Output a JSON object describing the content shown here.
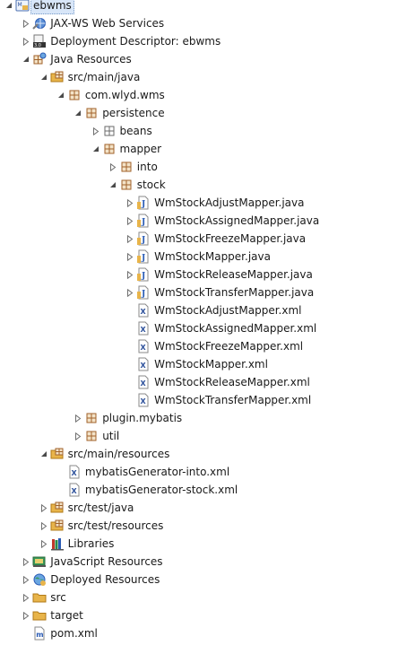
{
  "tree": {
    "nodes": [
      {
        "id": "ebwms",
        "label": "ebwms",
        "depth": 0,
        "state": "expanded",
        "icon": "project-icon",
        "selected": true
      },
      {
        "id": "jaxws",
        "label": "JAX-WS Web Services",
        "depth": 1,
        "state": "collapsed",
        "icon": "webservices-icon"
      },
      {
        "id": "deploydesc",
        "label": "Deployment Descriptor: ebwms",
        "depth": 1,
        "state": "collapsed",
        "icon": "deployment-descriptor-icon"
      },
      {
        "id": "javares",
        "label": "Java Resources",
        "depth": 1,
        "state": "expanded",
        "icon": "java-resources-icon"
      },
      {
        "id": "srcmainjava",
        "label": "src/main/java",
        "depth": 2,
        "state": "expanded",
        "icon": "source-folder-icon"
      },
      {
        "id": "comwlydwms",
        "label": "com.wlyd.wms",
        "depth": 3,
        "state": "expanded",
        "icon": "package-icon"
      },
      {
        "id": "persistence",
        "label": "persistence",
        "depth": 4,
        "state": "expanded",
        "icon": "package-icon"
      },
      {
        "id": "beans",
        "label": "beans",
        "depth": 5,
        "state": "collapsed",
        "icon": "package-empty-icon"
      },
      {
        "id": "mapper",
        "label": "mapper",
        "depth": 5,
        "state": "expanded",
        "icon": "package-icon"
      },
      {
        "id": "into",
        "label": "into",
        "depth": 6,
        "state": "collapsed",
        "icon": "package-icon"
      },
      {
        "id": "stock",
        "label": "stock",
        "depth": 6,
        "state": "expanded",
        "icon": "package-icon"
      },
      {
        "id": "j1",
        "label": "WmStockAdjustMapper.java",
        "depth": 7,
        "state": "collapsed",
        "icon": "java-file-icon"
      },
      {
        "id": "j2",
        "label": "WmStockAssignedMapper.java",
        "depth": 7,
        "state": "collapsed",
        "icon": "java-file-icon"
      },
      {
        "id": "j3",
        "label": "WmStockFreezeMapper.java",
        "depth": 7,
        "state": "collapsed",
        "icon": "java-file-icon"
      },
      {
        "id": "j4",
        "label": "WmStockMapper.java",
        "depth": 7,
        "state": "collapsed",
        "icon": "java-file-icon"
      },
      {
        "id": "j5",
        "label": "WmStockReleaseMapper.java",
        "depth": 7,
        "state": "collapsed",
        "icon": "java-file-icon"
      },
      {
        "id": "j6",
        "label": "WmStockTransferMapper.java",
        "depth": 7,
        "state": "collapsed",
        "icon": "java-file-icon"
      },
      {
        "id": "x1",
        "label": "WmStockAdjustMapper.xml",
        "depth": 7,
        "state": "leaf",
        "icon": "xml-file-icon"
      },
      {
        "id": "x2",
        "label": "WmStockAssignedMapper.xml",
        "depth": 7,
        "state": "leaf",
        "icon": "xml-file-icon"
      },
      {
        "id": "x3",
        "label": "WmStockFreezeMapper.xml",
        "depth": 7,
        "state": "leaf",
        "icon": "xml-file-icon"
      },
      {
        "id": "x4",
        "label": "WmStockMapper.xml",
        "depth": 7,
        "state": "leaf",
        "icon": "xml-file-icon"
      },
      {
        "id": "x5",
        "label": "WmStockReleaseMapper.xml",
        "depth": 7,
        "state": "leaf",
        "icon": "xml-file-icon"
      },
      {
        "id": "x6",
        "label": "WmStockTransferMapper.xml",
        "depth": 7,
        "state": "leaf",
        "icon": "xml-file-icon"
      },
      {
        "id": "pluginmybatis",
        "label": "plugin.mybatis",
        "depth": 4,
        "state": "collapsed",
        "icon": "package-icon"
      },
      {
        "id": "util",
        "label": "util",
        "depth": 4,
        "state": "collapsed",
        "icon": "package-icon"
      },
      {
        "id": "srcmainres",
        "label": "src/main/resources",
        "depth": 2,
        "state": "expanded",
        "icon": "source-folder-icon"
      },
      {
        "id": "mbginto",
        "label": "mybatisGenerator-into.xml",
        "depth": 3,
        "state": "leaf",
        "icon": "xml-file-icon"
      },
      {
        "id": "mbgstock",
        "label": "mybatisGenerator-stock.xml",
        "depth": 3,
        "state": "leaf",
        "icon": "xml-file-icon"
      },
      {
        "id": "srctestjava",
        "label": "src/test/java",
        "depth": 2,
        "state": "collapsed",
        "icon": "source-folder-icon"
      },
      {
        "id": "srctestres",
        "label": "src/test/resources",
        "depth": 2,
        "state": "collapsed",
        "icon": "source-folder-icon"
      },
      {
        "id": "libraries",
        "label": "Libraries",
        "depth": 2,
        "state": "collapsed",
        "icon": "libraries-icon"
      },
      {
        "id": "jsres",
        "label": "JavaScript Resources",
        "depth": 1,
        "state": "collapsed",
        "icon": "javascript-resources-icon"
      },
      {
        "id": "deployedres",
        "label": "Deployed Resources",
        "depth": 1,
        "state": "collapsed",
        "icon": "deployed-resources-icon"
      },
      {
        "id": "src",
        "label": "src",
        "depth": 1,
        "state": "collapsed",
        "icon": "folder-icon"
      },
      {
        "id": "target",
        "label": "target",
        "depth": 1,
        "state": "collapsed",
        "icon": "folder-icon"
      },
      {
        "id": "pom",
        "label": "pom.xml",
        "depth": 1,
        "state": "leaf",
        "icon": "maven-file-icon"
      }
    ]
  },
  "colors": {
    "folder": "#e8b44a",
    "package_brown": "#a0622a",
    "java_blue": "#2a5bb5",
    "xml_blue": "#2b4f9a",
    "twisty": "#707070"
  }
}
